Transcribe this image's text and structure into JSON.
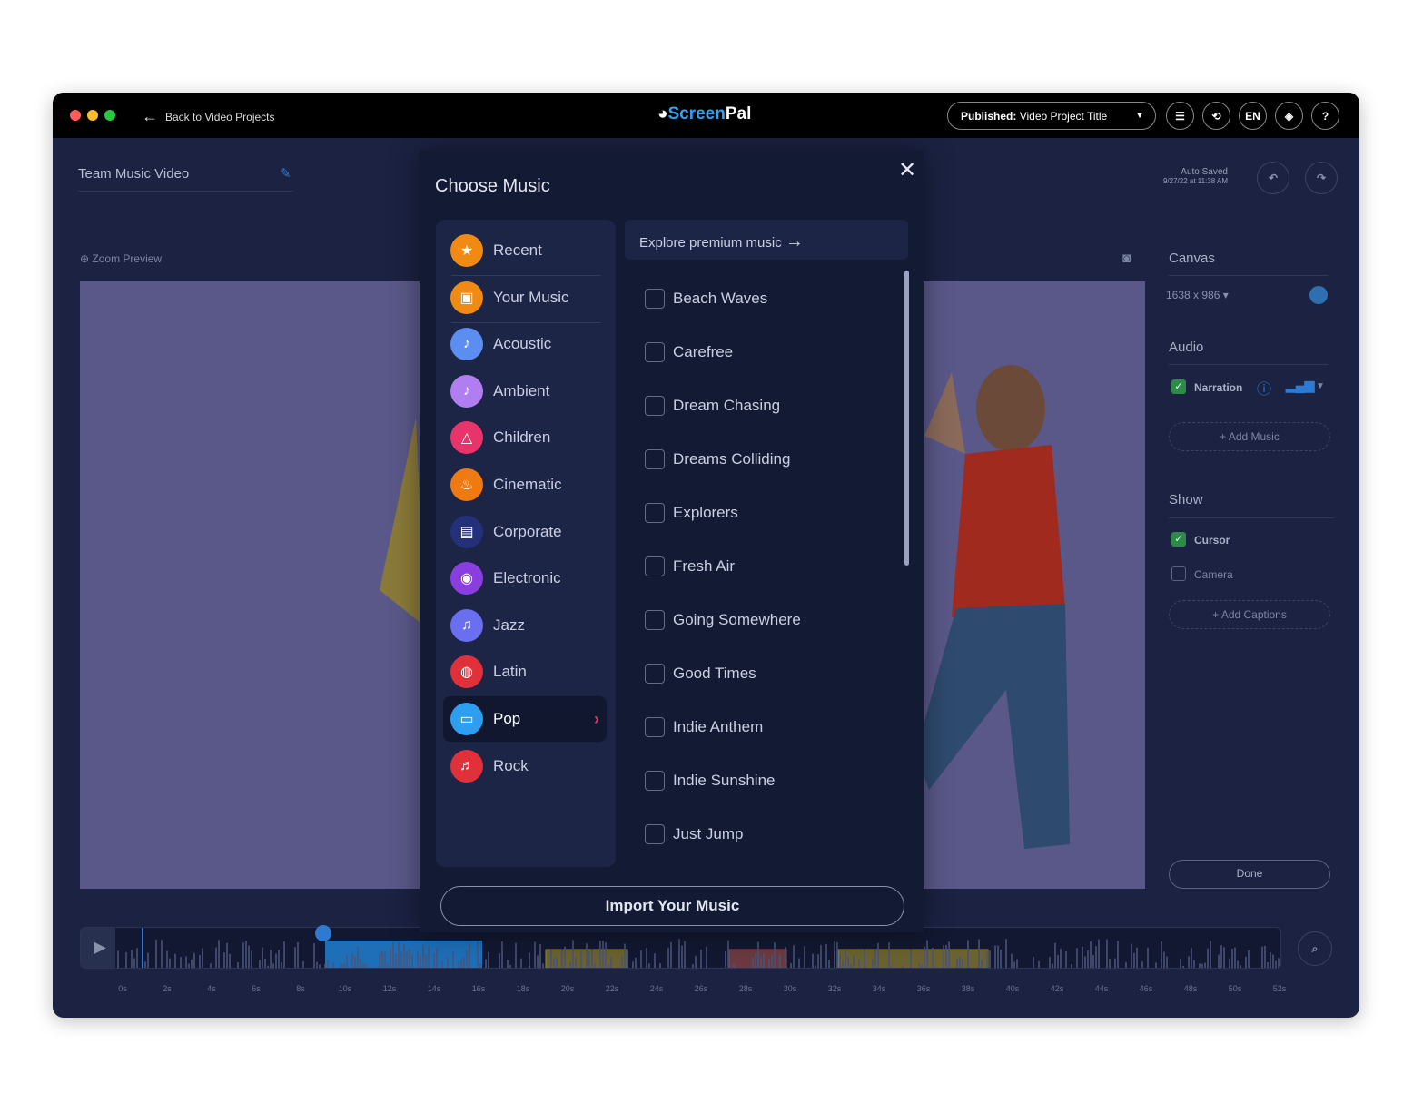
{
  "titlebar": {
    "back_label": "Back to Video Projects",
    "logo": "ScreenPal",
    "published_label": "Published:",
    "project_title": "Video Project Title",
    "lang": "EN",
    "traffic_colors": [
      "#ff5f57",
      "#febc2e",
      "#28c840"
    ]
  },
  "project": {
    "name": "Team Music Video",
    "auto_saved": "Auto Saved",
    "saved_time": "9/27/22 at 11:38 AM"
  },
  "preview": {
    "zoom_label": "Zoom Preview"
  },
  "right_panel": {
    "canvas_title": "Canvas",
    "canvas_size": "1638 x 986",
    "audio_title": "Audio",
    "narration_label": "Narration",
    "narration_checked": true,
    "add_music": "Add Music",
    "show_title": "Show",
    "cursor_label": "Cursor",
    "cursor_checked": true,
    "camera_label": "Camera",
    "camera_checked": false,
    "add_captions": "Add Captions",
    "done_label": "Done"
  },
  "modal": {
    "title": "Choose Music",
    "explore_label": "Explore premium music",
    "import_label": "Import Your Music",
    "categories": [
      {
        "label": "Recent",
        "icon": "sparkle-star-icon",
        "color": "#f08a12"
      },
      {
        "label": "Your Music",
        "icon": "folder-icon",
        "color": "#f08a12"
      },
      {
        "label": "Acoustic",
        "icon": "guitar-icon",
        "color": "#5b8ef0"
      },
      {
        "label": "Ambient",
        "icon": "guitar-icon",
        "color": "#b07ef0"
      },
      {
        "label": "Children",
        "icon": "triangle-instrument-icon",
        "color": "#e8336b"
      },
      {
        "label": "Cinematic",
        "icon": "popcorn-icon",
        "color": "#f07a12"
      },
      {
        "label": "Corporate",
        "icon": "briefcase-icon",
        "color": "#24307a"
      },
      {
        "label": "Electronic",
        "icon": "speaker-icon",
        "color": "#8a3ee0"
      },
      {
        "label": "Jazz",
        "icon": "saxophone-icon",
        "color": "#6a6ef0"
      },
      {
        "label": "Latin",
        "icon": "drum-icon",
        "color": "#e0303a"
      },
      {
        "label": "Pop",
        "icon": "radio-icon",
        "color": "#2e9ef0",
        "selected": true
      },
      {
        "label": "Rock",
        "icon": "electric-guitar-icon",
        "color": "#e0303a"
      }
    ],
    "tracks": [
      "Beach Waves",
      "Carefree",
      "Dream Chasing",
      "Dreams Colliding",
      "Explorers",
      "Fresh Air",
      "Going Somewhere",
      "Good Times",
      "Indie Anthem",
      "Indie Sunshine",
      "Just Jump"
    ]
  },
  "timeline": {
    "ticks": [
      "0s",
      "2s",
      "4s",
      "6s",
      "8s",
      "10s",
      "12s",
      "14s",
      "16s",
      "18s",
      "20s",
      "22s",
      "24s",
      "26s",
      "28s",
      "30s",
      "32s",
      "34s",
      "36s",
      "38s",
      "40s",
      "42s",
      "44s",
      "46s",
      "48s",
      "50s",
      "52s"
    ]
  }
}
